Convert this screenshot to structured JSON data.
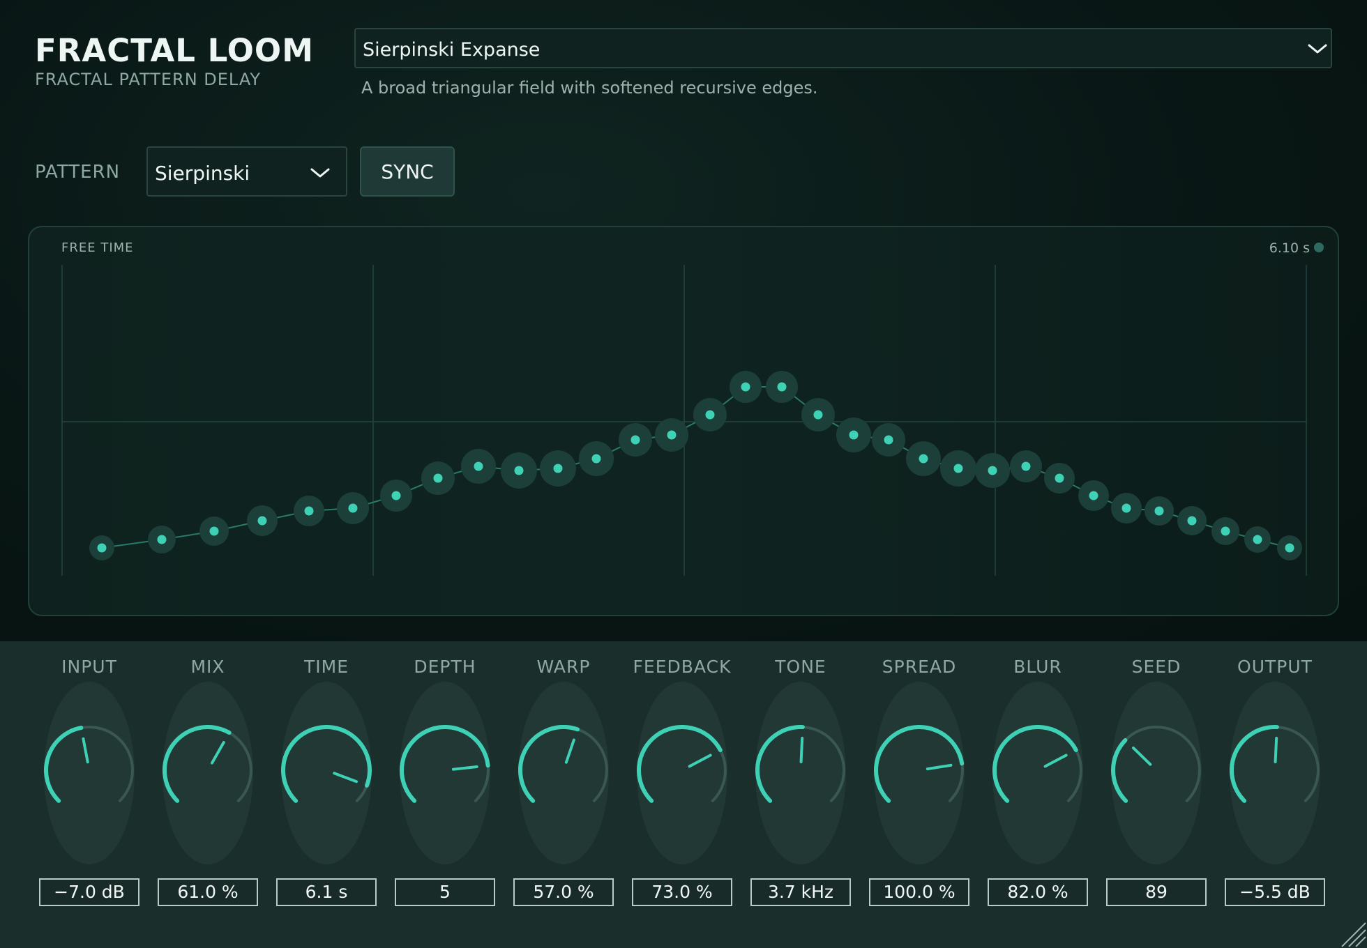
{
  "app": {
    "title": "FRACTAL LOOM",
    "subtitle": "FRACTAL PATTERN DELAY"
  },
  "preset": {
    "name": "Sierpinski Expanse",
    "description": "A broad triangular field with softened recursive edges."
  },
  "pattern": {
    "label": "PATTERN",
    "value": "Sierpinski",
    "sync_label": "SYNC"
  },
  "graph": {
    "mode_label": "FREE TIME",
    "time_readout": "6.10 s"
  },
  "knobs": [
    {
      "label": "INPUT",
      "value": "−7.0 dB",
      "position": 0.46
    },
    {
      "label": "MIX",
      "value": "61.0 %",
      "position": 0.61
    },
    {
      "label": "TIME",
      "value": "6.1 s",
      "position": 0.91
    },
    {
      "label": "DEPTH",
      "value": "5",
      "position": 0.81
    },
    {
      "label": "WARP",
      "value": "57.0 %",
      "position": 0.57
    },
    {
      "label": "FEEDBACK",
      "value": "73.0 %",
      "position": 0.73
    },
    {
      "label": "TONE",
      "value": "3.7 kHz",
      "position": 0.51
    },
    {
      "label": "SPREAD",
      "value": "100.0 %",
      "position": 0.8
    },
    {
      "label": "BLUR",
      "value": "82.0 %",
      "position": 0.73
    },
    {
      "label": "SEED",
      "value": "89",
      "position": 0.33
    },
    {
      "label": "OUTPUT",
      "value": "−5.5 dB",
      "position": 0.51
    }
  ],
  "colors": {
    "accent": "#3fd1b6",
    "track": "#3b5753",
    "panel_bg": "#1a2f2c"
  },
  "icons": {
    "dropdown": "chevron-down-icon",
    "resize": "resize-grip-icon"
  }
}
